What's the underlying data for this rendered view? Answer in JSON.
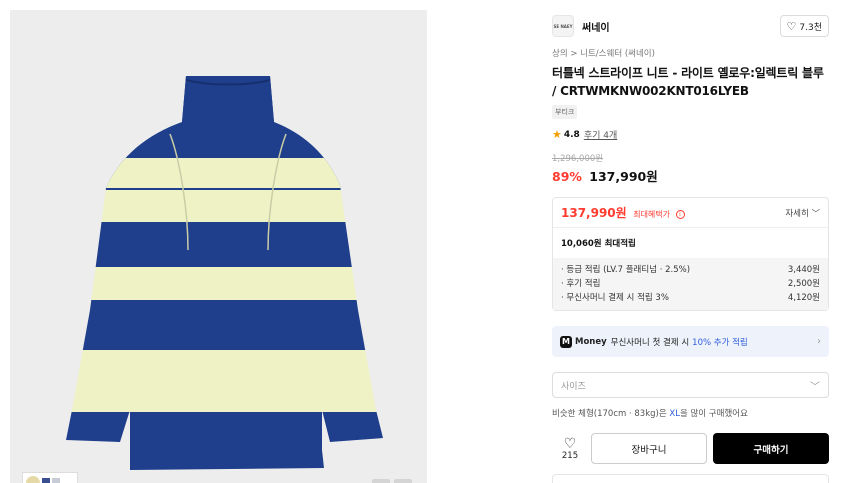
{
  "brand": {
    "logo_text": "SE NAEY",
    "name": "써네이",
    "likes": "7.3천"
  },
  "breadcrumb": {
    "level1": "상의",
    "separator": ">",
    "level2": "니트/스웨터 (써네이)"
  },
  "product": {
    "title": "터틀넥 스트라이프 니트 - 라이트 옐로우:일렉트릭 블루 / CRTWMKNW002KNT016LYEB",
    "tag": "부티크",
    "rating": "4.8",
    "reviews": "후기 4개",
    "original_price": "1,296,000원",
    "discount": "89%",
    "price": "137,990원"
  },
  "benefits": {
    "price": "137,990원",
    "max_label": "최대혜택가",
    "detail_label": "자세히",
    "points_total": "10,060원 최대적립",
    "items": [
      {
        "label": "· 등급 적립 (LV.7 플래티넘 · 2.5%)",
        "value": "3,440원"
      },
      {
        "label": "· 후기 적립",
        "value": "2,500원"
      },
      {
        "label": "· 무신사머니 결제 시 적립 3%",
        "value": "4,120원"
      }
    ]
  },
  "promo": {
    "badge": "M",
    "money": "Money",
    "text": "무신사머니 첫 결제 시",
    "highlight": "10% 추가 적립"
  },
  "size": {
    "placeholder": "사이즈"
  },
  "fit_note": {
    "prefix": "비슷한 체형(170cm · 83kg)은",
    "size": "XL",
    "suffix": "을 많이 구매했어요"
  },
  "actions": {
    "wish_count": "215",
    "cart": "장바구니",
    "buy": "구매하기"
  },
  "colors": {
    "stripe_blue": "#1f3f8c",
    "stripe_yellow": "#eef2c4",
    "discount_red": "#ff3b30",
    "accent_blue": "#2f5de0"
  }
}
